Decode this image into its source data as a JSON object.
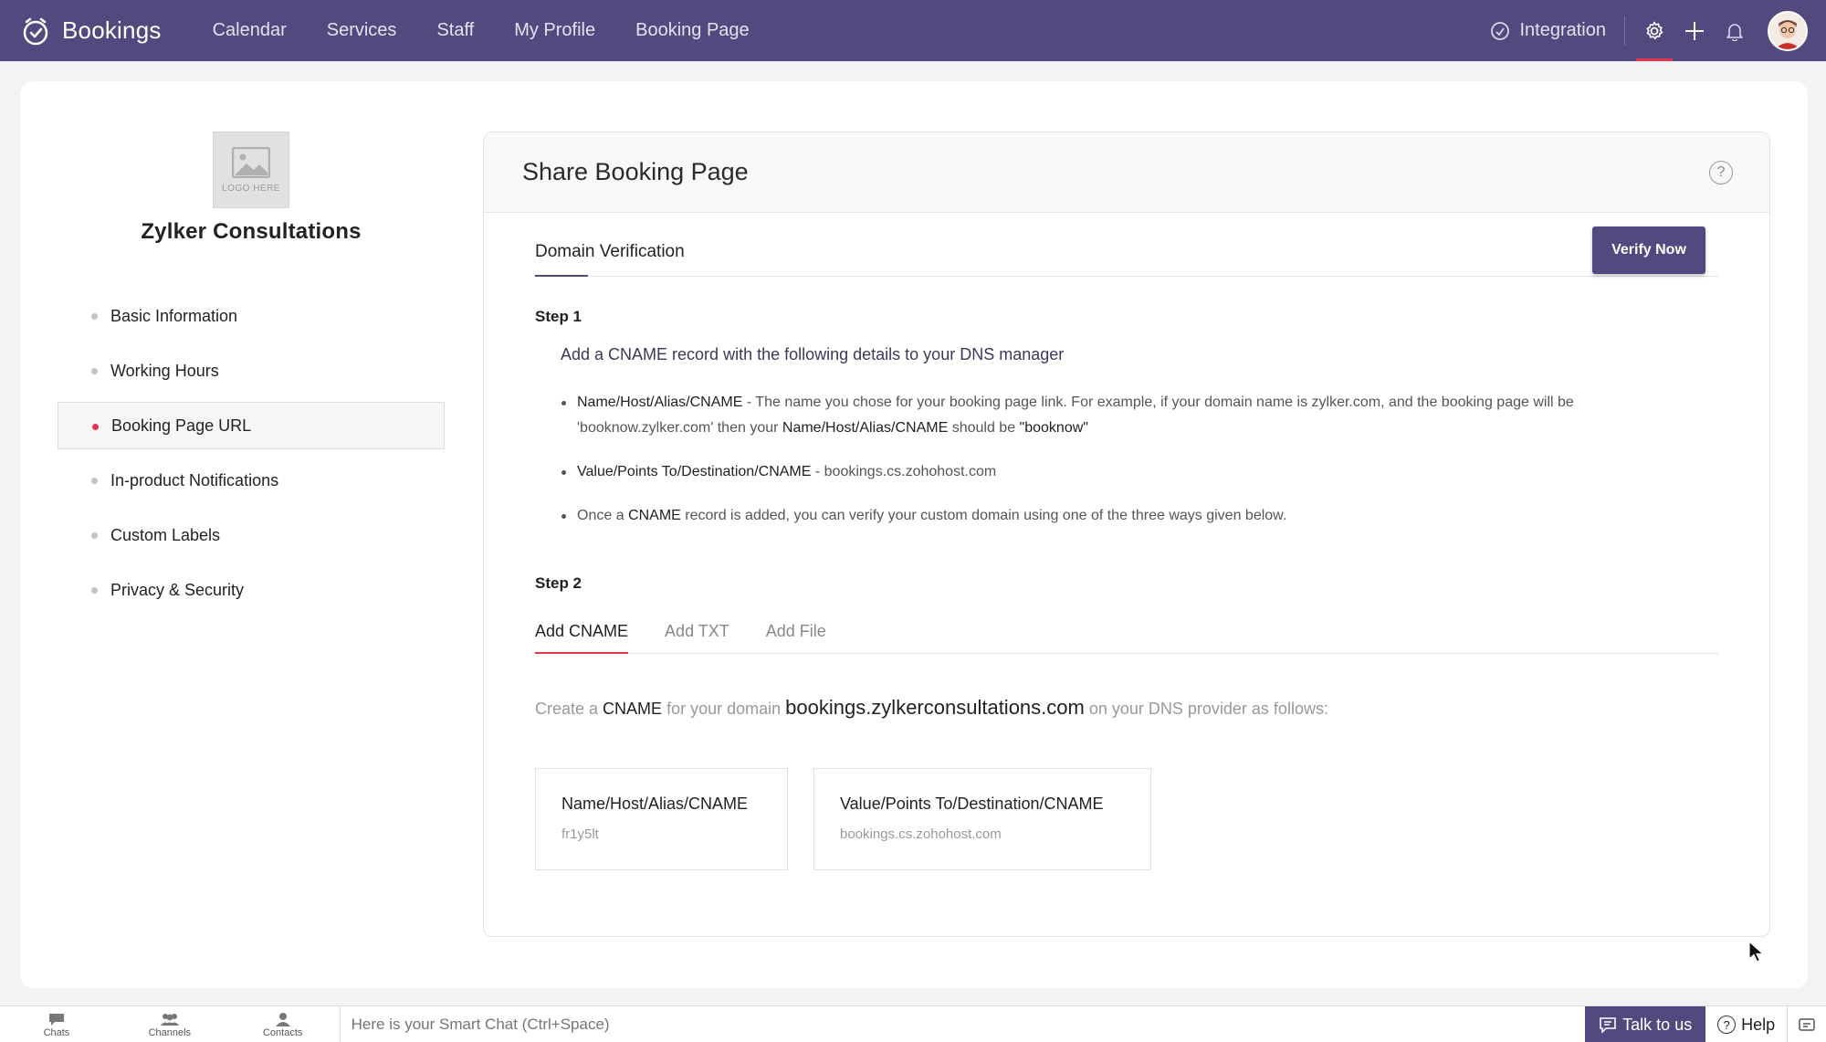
{
  "app": {
    "name": "Bookings"
  },
  "nav": [
    "Calendar",
    "Services",
    "Staff",
    "My Profile",
    "Booking Page"
  ],
  "top_right": {
    "integration_label": "Integration"
  },
  "org": {
    "logo_placeholder": "LOGO HERE",
    "name": "Zylker Consultations"
  },
  "sidebar": {
    "items": [
      {
        "label": "Basic Information",
        "active": false
      },
      {
        "label": "Working Hours",
        "active": false
      },
      {
        "label": "Booking Page URL",
        "active": true
      },
      {
        "label": "In-product Notifications",
        "active": false
      },
      {
        "label": "Custom Labels",
        "active": false
      },
      {
        "label": "Privacy & Security",
        "active": false
      }
    ]
  },
  "panel": {
    "title": "Share Booking Page",
    "help_glyph": "?",
    "domain_verification_label": "Domain Verification",
    "verify_button": "Verify Now",
    "step1": {
      "label": "Step 1",
      "description": "Add a CNAME record with the following details to your DNS manager",
      "bullet1": {
        "term": "Name/Host/Alias/CNAME",
        "text": " - The name you chose for your booking page link. For example, if your domain name is zylker.com, and the booking page will be 'booknow.zylker.com' then your ",
        "term2": "Name/Host/Alias/CNAME",
        "text2": " should be ",
        "example": "\"booknow\""
      },
      "bullet2": {
        "term": "Value/Points To/Destination/CNAME",
        "text": " - bookings.cs.zohohost.com"
      },
      "bullet3": {
        "text_before": "Once a ",
        "term": "CNAME",
        "text_after": " record is added, you can verify your custom domain using one of the three ways given below."
      }
    },
    "step2": {
      "label": "Step 2",
      "tabs": [
        {
          "label": "Add CNAME",
          "active": true
        },
        {
          "label": "Add TXT",
          "active": false
        },
        {
          "label": "Add File",
          "active": false
        }
      ],
      "create_prefix": "Create a ",
      "create_term": "CNAME",
      "create_mid": " for your domain ",
      "domain": "bookings.zylkerconsultations.com",
      "create_suffix": " on your DNS provider as follows:",
      "records": [
        {
          "title": "Name/Host/Alias/CNAME",
          "value": "fr1y5lt"
        },
        {
          "title": "Value/Points To/Destination/CNAME",
          "value": "bookings.cs.zohohost.com"
        }
      ]
    }
  },
  "bottombar": {
    "tabs": [
      "Chats",
      "Channels",
      "Contacts"
    ],
    "smart_chat_placeholder": "Here is your Smart Chat (Ctrl+Space)",
    "talk_label": "Talk to us",
    "help_label": "Help",
    "help_glyph": "?"
  },
  "colors": {
    "brand": "#54497e",
    "accent": "#e3344f"
  }
}
